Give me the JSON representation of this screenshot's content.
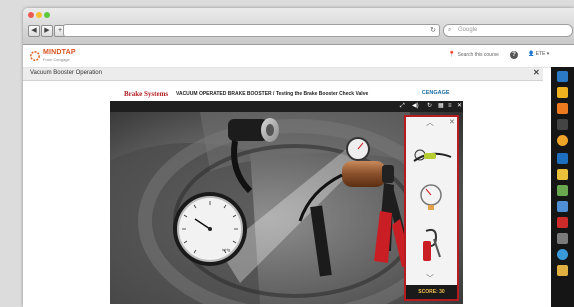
{
  "browser": {
    "nav_back": "◀",
    "nav_forward": "▶",
    "nav_add": "+",
    "reload": "↻",
    "search_placeholder": "Google"
  },
  "app": {
    "brand_name": "MINDTAP",
    "brand_sub": "From Cengage",
    "search_button": "Search this course",
    "help_icon": "?",
    "user_menu": "ETE ▾"
  },
  "activity": {
    "title": "Vacuum Booster Operation",
    "close": "✕"
  },
  "simulation": {
    "topic": "Brake Systems",
    "subtitle": "VACUUM OPERATED BRAKE BOOSTER / Testing the Brake Booster Check Valve",
    "publisher": "CENGAGE",
    "toolbar_icons": [
      "fullscreen-icon",
      "volume-icon",
      "reset-icon",
      "grid-icon",
      "menu-icon",
      "close-icon"
    ],
    "panel_close": "✕",
    "score_label": "SCORE: 30",
    "gauge_unit": "inHg"
  },
  "colors": {
    "brand_orange": "#d9531e",
    "topic_red": "#b41e24",
    "cengage_blue": "#1b6ea7",
    "panel_border": "#b51c22",
    "score_text": "#f2c04a"
  },
  "dock_icons": [
    "cloud-icon",
    "pencil-icon",
    "rss-icon",
    "wrench-icon",
    "sun-icon",
    "book-icon",
    "note-icon",
    "puzzle-icon",
    "image-icon",
    "bookmark-icon",
    "chat-icon",
    "globe-icon",
    "flag-icon"
  ]
}
